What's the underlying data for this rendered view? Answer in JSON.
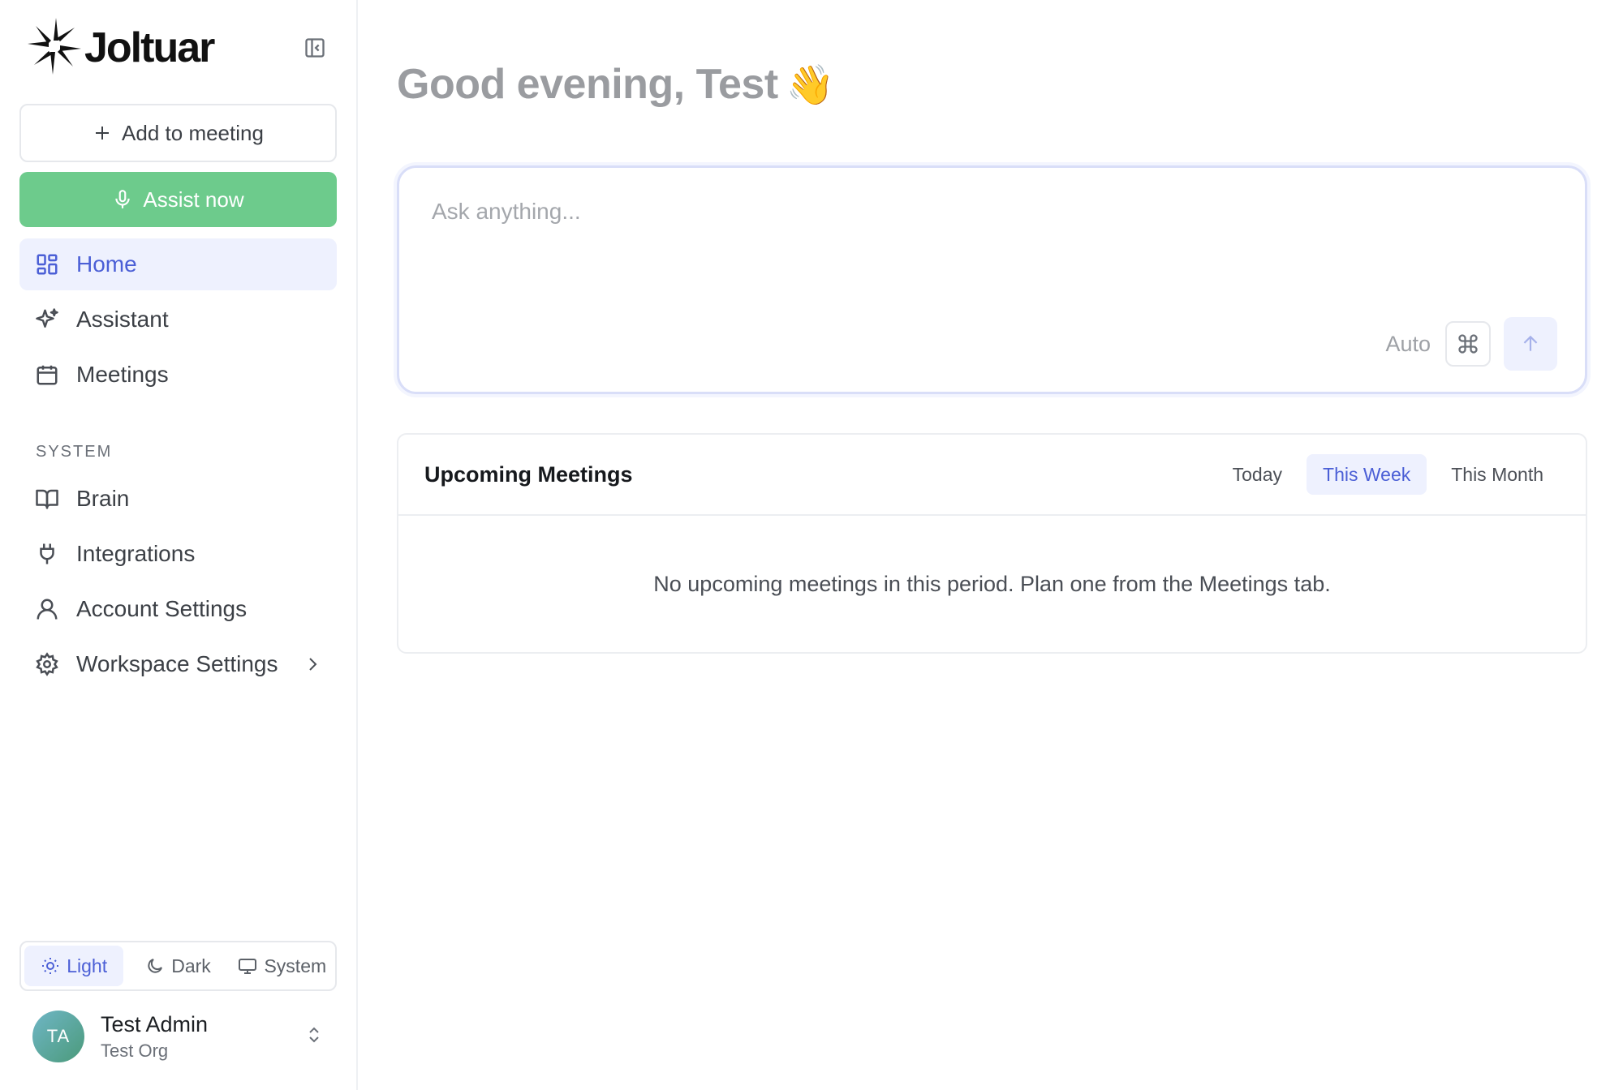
{
  "brand": {
    "name": "Joltuar"
  },
  "sidebar": {
    "add_meeting_label": "Add to meeting",
    "assist_now_label": "Assist now",
    "nav": [
      {
        "label": "Home",
        "icon": "dashboard-icon",
        "active": true
      },
      {
        "label": "Assistant",
        "icon": "sparkle-icon"
      },
      {
        "label": "Meetings",
        "icon": "calendar-icon"
      }
    ],
    "system_section_label": "SYSTEM",
    "system_nav": [
      {
        "label": "Brain",
        "icon": "book-icon"
      },
      {
        "label": "Integrations",
        "icon": "plug-icon"
      },
      {
        "label": "Account Settings",
        "icon": "user-icon"
      },
      {
        "label": "Workspace Settings",
        "icon": "gear-icon"
      }
    ],
    "theme": {
      "options": [
        "Light",
        "Dark",
        "System"
      ],
      "selected": "Light"
    },
    "user": {
      "initials": "TA",
      "name": "Test Admin",
      "org": "Test Org"
    }
  },
  "main": {
    "greeting": "Good evening, Test",
    "greeting_emoji": "👋",
    "ask": {
      "placeholder": "Ask anything...",
      "mode_label": "Auto"
    },
    "meetings": {
      "title": "Upcoming Meetings",
      "tabs": [
        "Today",
        "This Week",
        "This Month"
      ],
      "selected_tab": "This Week",
      "empty_message": "No upcoming meetings in this period. Plan one from the Meetings tab."
    }
  },
  "colors": {
    "accent": "#4b5fd6",
    "accent_bg": "#eef1fe",
    "green": "#6dcb8c"
  }
}
